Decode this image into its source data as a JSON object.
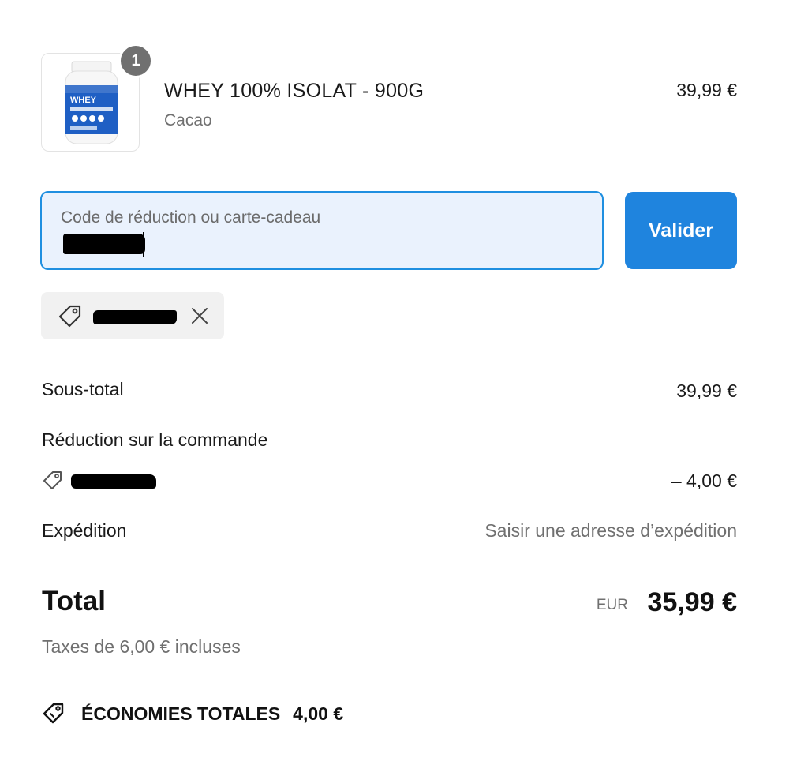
{
  "product": {
    "quantity": "1",
    "name": "WHEY 100% ISOLAT - 900G",
    "variant": "Cacao",
    "price": "39,99 €",
    "image_icon": "whey-jar-image"
  },
  "discount_field": {
    "placeholder": "Code de réduction ou carte-cadeau",
    "button_label": "Valider"
  },
  "applied_code": {
    "icon": "tag-icon",
    "remove_icon": "close-icon"
  },
  "summary": {
    "subtotal_label": "Sous-total",
    "subtotal_value": "39,99 €",
    "order_discount_label": "Réduction sur la commande",
    "order_discount_value": "– 4,00 €",
    "shipping_label": "Expédition",
    "shipping_value": "Saisir une adresse d’expédition"
  },
  "total": {
    "label": "Total",
    "currency": "EUR",
    "value": "35,99 €",
    "taxes": "Taxes de 6,00 € incluses"
  },
  "savings": {
    "label": "ÉCONOMIES TOTALES",
    "value": "4,00 €"
  },
  "colors": {
    "accent": "#1f84de",
    "field_background": "#eaf2fd",
    "muted_text": "#707070"
  }
}
